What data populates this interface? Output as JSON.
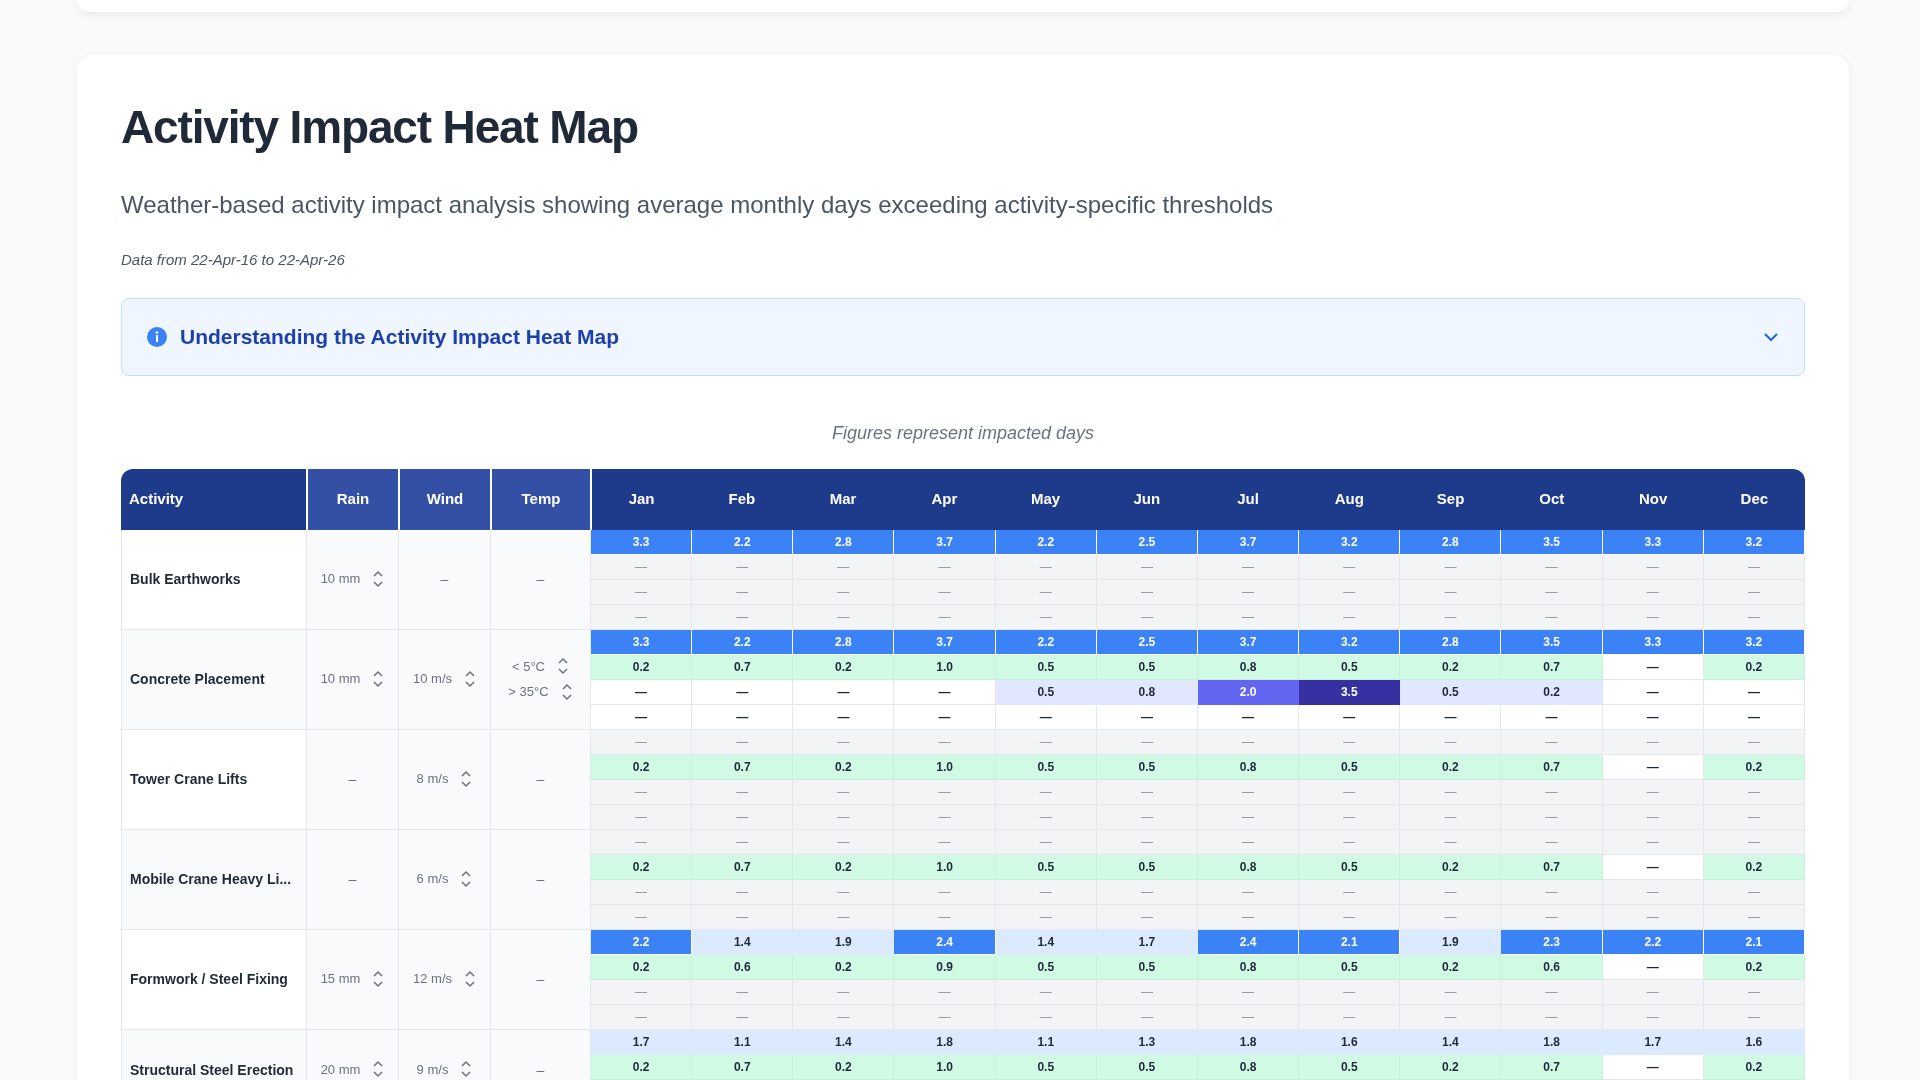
{
  "page_title": "Activity Impact Heat Map",
  "subtitle": "Weather-based activity impact analysis showing average monthly days exceeding activity-specific thresholds",
  "date_range": "Data from 22-Apr-16 to 22-Apr-26",
  "info_panel": {
    "title": "Understanding the Activity Impact Heat Map",
    "expanded": false
  },
  "caption": "Figures represent impacted days",
  "table": {
    "columns": [
      "Activity",
      "Rain",
      "Wind",
      "Temp"
    ],
    "months": [
      "Jan",
      "Feb",
      "Mar",
      "Apr",
      "May",
      "Jun",
      "Jul",
      "Aug",
      "Sep",
      "Oct",
      "Nov",
      "Dec"
    ],
    "activities": [
      {
        "name": "Bulk Earthworks",
        "rain": [
          {
            "text": "10 mm",
            "kind": "stepper"
          }
        ],
        "wind": [
          {
            "text": "–",
            "kind": "none"
          }
        ],
        "temp": [
          {
            "text": "–",
            "kind": "none"
          }
        ],
        "rows": [
          {
            "cells": [
              {
                "value": "3.3",
                "kind": "rain-high"
              },
              {
                "value": "2.2",
                "kind": "rain-high"
              },
              {
                "value": "2.8",
                "kind": "rain-high"
              },
              {
                "value": "3.7",
                "kind": "rain-high"
              },
              {
                "value": "2.2",
                "kind": "rain-high"
              },
              {
                "value": "2.5",
                "kind": "rain-high"
              },
              {
                "value": "3.7",
                "kind": "rain-high"
              },
              {
                "value": "3.2",
                "kind": "rain-high"
              },
              {
                "value": "2.8",
                "kind": "rain-high"
              },
              {
                "value": "3.5",
                "kind": "rain-high"
              },
              {
                "value": "3.3",
                "kind": "rain-high"
              },
              {
                "value": "3.2",
                "kind": "rain-high"
              }
            ]
          },
          {
            "cells": [
              {
                "value": "—",
                "kind": "na"
              },
              {
                "value": "—",
                "kind": "na"
              },
              {
                "value": "—",
                "kind": "na"
              },
              {
                "value": "—",
                "kind": "na"
              },
              {
                "value": "—",
                "kind": "na"
              },
              {
                "value": "—",
                "kind": "na"
              },
              {
                "value": "—",
                "kind": "na"
              },
              {
                "value": "—",
                "kind": "na"
              },
              {
                "value": "—",
                "kind": "na"
              },
              {
                "value": "—",
                "kind": "na"
              },
              {
                "value": "—",
                "kind": "na"
              },
              {
                "value": "—",
                "kind": "na"
              }
            ]
          },
          {
            "cells": [
              {
                "value": "—",
                "kind": "na"
              },
              {
                "value": "—",
                "kind": "na"
              },
              {
                "value": "—",
                "kind": "na"
              },
              {
                "value": "—",
                "kind": "na"
              },
              {
                "value": "—",
                "kind": "na"
              },
              {
                "value": "—",
                "kind": "na"
              },
              {
                "value": "—",
                "kind": "na"
              },
              {
                "value": "—",
                "kind": "na"
              },
              {
                "value": "—",
                "kind": "na"
              },
              {
                "value": "—",
                "kind": "na"
              },
              {
                "value": "—",
                "kind": "na"
              },
              {
                "value": "—",
                "kind": "na"
              }
            ]
          },
          {
            "cells": [
              {
                "value": "—",
                "kind": "na"
              },
              {
                "value": "—",
                "kind": "na"
              },
              {
                "value": "—",
                "kind": "na"
              },
              {
                "value": "—",
                "kind": "na"
              },
              {
                "value": "—",
                "kind": "na"
              },
              {
                "value": "—",
                "kind": "na"
              },
              {
                "value": "—",
                "kind": "na"
              },
              {
                "value": "—",
                "kind": "na"
              },
              {
                "value": "—",
                "kind": "na"
              },
              {
                "value": "—",
                "kind": "na"
              },
              {
                "value": "—",
                "kind": "na"
              },
              {
                "value": "—",
                "kind": "na"
              }
            ]
          }
        ]
      },
      {
        "name": "Concrete Placement",
        "rain": [
          {
            "text": "10 mm",
            "kind": "stepper"
          }
        ],
        "wind": [
          {
            "text": "10 m/s",
            "kind": "stepper"
          }
        ],
        "temp": [
          {
            "text": "< 5°C",
            "kind": "stepper"
          },
          {
            "text": "> 35°C",
            "kind": "stepper"
          }
        ],
        "rows": [
          {
            "cells": [
              {
                "value": "3.3",
                "kind": "rain-high"
              },
              {
                "value": "2.2",
                "kind": "rain-high"
              },
              {
                "value": "2.8",
                "kind": "rain-high"
              },
              {
                "value": "3.7",
                "kind": "rain-high"
              },
              {
                "value": "2.2",
                "kind": "rain-high"
              },
              {
                "value": "2.5",
                "kind": "rain-high"
              },
              {
                "value": "3.7",
                "kind": "rain-high"
              },
              {
                "value": "3.2",
                "kind": "rain-high"
              },
              {
                "value": "2.8",
                "kind": "rain-high"
              },
              {
                "value": "3.5",
                "kind": "rain-high"
              },
              {
                "value": "3.3",
                "kind": "rain-high"
              },
              {
                "value": "3.2",
                "kind": "rain-high"
              }
            ]
          },
          {
            "cells": [
              {
                "value": "0.2",
                "kind": "wind"
              },
              {
                "value": "0.7",
                "kind": "wind"
              },
              {
                "value": "0.2",
                "kind": "wind"
              },
              {
                "value": "1.0",
                "kind": "wind"
              },
              {
                "value": "0.5",
                "kind": "wind"
              },
              {
                "value": "0.5",
                "kind": "wind"
              },
              {
                "value": "0.8",
                "kind": "wind"
              },
              {
                "value": "0.5",
                "kind": "wind"
              },
              {
                "value": "0.2",
                "kind": "wind"
              },
              {
                "value": "0.7",
                "kind": "wind"
              },
              {
                "value": "—",
                "kind": "zero"
              },
              {
                "value": "0.2",
                "kind": "wind"
              }
            ]
          },
          {
            "cells": [
              {
                "value": "—",
                "kind": "zero"
              },
              {
                "value": "—",
                "kind": "zero"
              },
              {
                "value": "—",
                "kind": "zero"
              },
              {
                "value": "—",
                "kind": "zero"
              },
              {
                "value": "0.5",
                "kind": "temp-low"
              },
              {
                "value": "0.8",
                "kind": "temp-low"
              },
              {
                "value": "2.0",
                "kind": "temp-mid"
              },
              {
                "value": "3.5",
                "kind": "temp-high"
              },
              {
                "value": "0.5",
                "kind": "temp-low"
              },
              {
                "value": "0.2",
                "kind": "temp-low"
              },
              {
                "value": "—",
                "kind": "zero"
              },
              {
                "value": "—",
                "kind": "zero"
              }
            ]
          },
          {
            "cells": [
              {
                "value": "—",
                "kind": "zero"
              },
              {
                "value": "—",
                "kind": "zero"
              },
              {
                "value": "—",
                "kind": "zero"
              },
              {
                "value": "—",
                "kind": "zero"
              },
              {
                "value": "—",
                "kind": "zero"
              },
              {
                "value": "—",
                "kind": "zero"
              },
              {
                "value": "—",
                "kind": "zero"
              },
              {
                "value": "—",
                "kind": "zero"
              },
              {
                "value": "—",
                "kind": "zero"
              },
              {
                "value": "—",
                "kind": "zero"
              },
              {
                "value": "—",
                "kind": "zero"
              },
              {
                "value": "—",
                "kind": "zero"
              }
            ]
          }
        ]
      },
      {
        "name": "Tower Crane Lifts",
        "rain": [
          {
            "text": "–",
            "kind": "none"
          }
        ],
        "wind": [
          {
            "text": "8 m/s",
            "kind": "stepper"
          }
        ],
        "temp": [
          {
            "text": "–",
            "kind": "none"
          }
        ],
        "rows": [
          {
            "cells": [
              {
                "value": "—",
                "kind": "na"
              },
              {
                "value": "—",
                "kind": "na"
              },
              {
                "value": "—",
                "kind": "na"
              },
              {
                "value": "—",
                "kind": "na"
              },
              {
                "value": "—",
                "kind": "na"
              },
              {
                "value": "—",
                "kind": "na"
              },
              {
                "value": "—",
                "kind": "na"
              },
              {
                "value": "—",
                "kind": "na"
              },
              {
                "value": "—",
                "kind": "na"
              },
              {
                "value": "—",
                "kind": "na"
              },
              {
                "value": "—",
                "kind": "na"
              },
              {
                "value": "—",
                "kind": "na"
              }
            ]
          },
          {
            "cells": [
              {
                "value": "0.2",
                "kind": "wind"
              },
              {
                "value": "0.7",
                "kind": "wind"
              },
              {
                "value": "0.2",
                "kind": "wind"
              },
              {
                "value": "1.0",
                "kind": "wind"
              },
              {
                "value": "0.5",
                "kind": "wind"
              },
              {
                "value": "0.5",
                "kind": "wind"
              },
              {
                "value": "0.8",
                "kind": "wind"
              },
              {
                "value": "0.5",
                "kind": "wind"
              },
              {
                "value": "0.2",
                "kind": "wind"
              },
              {
                "value": "0.7",
                "kind": "wind"
              },
              {
                "value": "—",
                "kind": "zero"
              },
              {
                "value": "0.2",
                "kind": "wind"
              }
            ]
          },
          {
            "cells": [
              {
                "value": "—",
                "kind": "na"
              },
              {
                "value": "—",
                "kind": "na"
              },
              {
                "value": "—",
                "kind": "na"
              },
              {
                "value": "—",
                "kind": "na"
              },
              {
                "value": "—",
                "kind": "na"
              },
              {
                "value": "—",
                "kind": "na"
              },
              {
                "value": "—",
                "kind": "na"
              },
              {
                "value": "—",
                "kind": "na"
              },
              {
                "value": "—",
                "kind": "na"
              },
              {
                "value": "—",
                "kind": "na"
              },
              {
                "value": "—",
                "kind": "na"
              },
              {
                "value": "—",
                "kind": "na"
              }
            ]
          },
          {
            "cells": [
              {
                "value": "—",
                "kind": "na"
              },
              {
                "value": "—",
                "kind": "na"
              },
              {
                "value": "—",
                "kind": "na"
              },
              {
                "value": "—",
                "kind": "na"
              },
              {
                "value": "—",
                "kind": "na"
              },
              {
                "value": "—",
                "kind": "na"
              },
              {
                "value": "—",
                "kind": "na"
              },
              {
                "value": "—",
                "kind": "na"
              },
              {
                "value": "—",
                "kind": "na"
              },
              {
                "value": "—",
                "kind": "na"
              },
              {
                "value": "—",
                "kind": "na"
              },
              {
                "value": "—",
                "kind": "na"
              }
            ]
          }
        ]
      },
      {
        "name": "Mobile Crane Heavy Li...",
        "rain": [
          {
            "text": "–",
            "kind": "none"
          }
        ],
        "wind": [
          {
            "text": "6 m/s",
            "kind": "stepper"
          }
        ],
        "temp": [
          {
            "text": "–",
            "kind": "none"
          }
        ],
        "rows": [
          {
            "cells": [
              {
                "value": "—",
                "kind": "na"
              },
              {
                "value": "—",
                "kind": "na"
              },
              {
                "value": "—",
                "kind": "na"
              },
              {
                "value": "—",
                "kind": "na"
              },
              {
                "value": "—",
                "kind": "na"
              },
              {
                "value": "—",
                "kind": "na"
              },
              {
                "value": "—",
                "kind": "na"
              },
              {
                "value": "—",
                "kind": "na"
              },
              {
                "value": "—",
                "kind": "na"
              },
              {
                "value": "—",
                "kind": "na"
              },
              {
                "value": "—",
                "kind": "na"
              },
              {
                "value": "—",
                "kind": "na"
              }
            ]
          },
          {
            "cells": [
              {
                "value": "0.2",
                "kind": "wind"
              },
              {
                "value": "0.7",
                "kind": "wind"
              },
              {
                "value": "0.2",
                "kind": "wind"
              },
              {
                "value": "1.0",
                "kind": "wind"
              },
              {
                "value": "0.5",
                "kind": "wind"
              },
              {
                "value": "0.5",
                "kind": "wind"
              },
              {
                "value": "0.8",
                "kind": "wind"
              },
              {
                "value": "0.5",
                "kind": "wind"
              },
              {
                "value": "0.2",
                "kind": "wind"
              },
              {
                "value": "0.7",
                "kind": "wind"
              },
              {
                "value": "—",
                "kind": "zero"
              },
              {
                "value": "0.2",
                "kind": "wind"
              }
            ]
          },
          {
            "cells": [
              {
                "value": "—",
                "kind": "na"
              },
              {
                "value": "—",
                "kind": "na"
              },
              {
                "value": "—",
                "kind": "na"
              },
              {
                "value": "—",
                "kind": "na"
              },
              {
                "value": "—",
                "kind": "na"
              },
              {
                "value": "—",
                "kind": "na"
              },
              {
                "value": "—",
                "kind": "na"
              },
              {
                "value": "—",
                "kind": "na"
              },
              {
                "value": "—",
                "kind": "na"
              },
              {
                "value": "—",
                "kind": "na"
              },
              {
                "value": "—",
                "kind": "na"
              },
              {
                "value": "—",
                "kind": "na"
              }
            ]
          },
          {
            "cells": [
              {
                "value": "—",
                "kind": "na"
              },
              {
                "value": "—",
                "kind": "na"
              },
              {
                "value": "—",
                "kind": "na"
              },
              {
                "value": "—",
                "kind": "na"
              },
              {
                "value": "—",
                "kind": "na"
              },
              {
                "value": "—",
                "kind": "na"
              },
              {
                "value": "—",
                "kind": "na"
              },
              {
                "value": "—",
                "kind": "na"
              },
              {
                "value": "—",
                "kind": "na"
              },
              {
                "value": "—",
                "kind": "na"
              },
              {
                "value": "—",
                "kind": "na"
              },
              {
                "value": "—",
                "kind": "na"
              }
            ]
          }
        ]
      },
      {
        "name": "Formwork / Steel Fixing",
        "rain": [
          {
            "text": "15 mm",
            "kind": "stepper"
          }
        ],
        "wind": [
          {
            "text": "12 m/s",
            "kind": "stepper"
          }
        ],
        "temp": [
          {
            "text": "–",
            "kind": "none"
          }
        ],
        "rows": [
          {
            "cells": [
              {
                "value": "2.2",
                "kind": "rain-high"
              },
              {
                "value": "1.4",
                "kind": "rain-low"
              },
              {
                "value": "1.9",
                "kind": "rain-low"
              },
              {
                "value": "2.4",
                "kind": "rain-high"
              },
              {
                "value": "1.4",
                "kind": "rain-low"
              },
              {
                "value": "1.7",
                "kind": "rain-low"
              },
              {
                "value": "2.4",
                "kind": "rain-high"
              },
              {
                "value": "2.1",
                "kind": "rain-high"
              },
              {
                "value": "1.9",
                "kind": "rain-low"
              },
              {
                "value": "2.3",
                "kind": "rain-high"
              },
              {
                "value": "2.2",
                "kind": "rain-high"
              },
              {
                "value": "2.1",
                "kind": "rain-high"
              }
            ]
          },
          {
            "cells": [
              {
                "value": "0.2",
                "kind": "wind"
              },
              {
                "value": "0.6",
                "kind": "wind"
              },
              {
                "value": "0.2",
                "kind": "wind"
              },
              {
                "value": "0.9",
                "kind": "wind"
              },
              {
                "value": "0.5",
                "kind": "wind"
              },
              {
                "value": "0.5",
                "kind": "wind"
              },
              {
                "value": "0.8",
                "kind": "wind"
              },
              {
                "value": "0.5",
                "kind": "wind"
              },
              {
                "value": "0.2",
                "kind": "wind"
              },
              {
                "value": "0.6",
                "kind": "wind"
              },
              {
                "value": "—",
                "kind": "zero"
              },
              {
                "value": "0.2",
                "kind": "wind"
              }
            ]
          },
          {
            "cells": [
              {
                "value": "—",
                "kind": "na"
              },
              {
                "value": "—",
                "kind": "na"
              },
              {
                "value": "—",
                "kind": "na"
              },
              {
                "value": "—",
                "kind": "na"
              },
              {
                "value": "—",
                "kind": "na"
              },
              {
                "value": "—",
                "kind": "na"
              },
              {
                "value": "—",
                "kind": "na"
              },
              {
                "value": "—",
                "kind": "na"
              },
              {
                "value": "—",
                "kind": "na"
              },
              {
                "value": "—",
                "kind": "na"
              },
              {
                "value": "—",
                "kind": "na"
              },
              {
                "value": "—",
                "kind": "na"
              }
            ]
          },
          {
            "cells": [
              {
                "value": "—",
                "kind": "na"
              },
              {
                "value": "—",
                "kind": "na"
              },
              {
                "value": "—",
                "kind": "na"
              },
              {
                "value": "—",
                "kind": "na"
              },
              {
                "value": "—",
                "kind": "na"
              },
              {
                "value": "—",
                "kind": "na"
              },
              {
                "value": "—",
                "kind": "na"
              },
              {
                "value": "—",
                "kind": "na"
              },
              {
                "value": "—",
                "kind": "na"
              },
              {
                "value": "—",
                "kind": "na"
              },
              {
                "value": "—",
                "kind": "na"
              },
              {
                "value": "—",
                "kind": "na"
              }
            ]
          }
        ]
      },
      {
        "name": "Structural Steel Erection",
        "rain": [
          {
            "text": "20 mm",
            "kind": "stepper"
          }
        ],
        "wind": [
          {
            "text": "9 m/s",
            "kind": "stepper"
          }
        ],
        "temp": [
          {
            "text": "–",
            "kind": "none"
          }
        ],
        "rows": [
          {
            "cells": [
              {
                "value": "1.7",
                "kind": "rain-low"
              },
              {
                "value": "1.1",
                "kind": "rain-low"
              },
              {
                "value": "1.4",
                "kind": "rain-low"
              },
              {
                "value": "1.8",
                "kind": "rain-low"
              },
              {
                "value": "1.1",
                "kind": "rain-low"
              },
              {
                "value": "1.3",
                "kind": "rain-low"
              },
              {
                "value": "1.8",
                "kind": "rain-low"
              },
              {
                "value": "1.6",
                "kind": "rain-low"
              },
              {
                "value": "1.4",
                "kind": "rain-low"
              },
              {
                "value": "1.8",
                "kind": "rain-low"
              },
              {
                "value": "1.7",
                "kind": "rain-low"
              },
              {
                "value": "1.6",
                "kind": "rain-low"
              }
            ]
          },
          {
            "cells": [
              {
                "value": "0.2",
                "kind": "wind"
              },
              {
                "value": "0.7",
                "kind": "wind"
              },
              {
                "value": "0.2",
                "kind": "wind"
              },
              {
                "value": "1.0",
                "kind": "wind"
              },
              {
                "value": "0.5",
                "kind": "wind"
              },
              {
                "value": "0.5",
                "kind": "wind"
              },
              {
                "value": "0.8",
                "kind": "wind"
              },
              {
                "value": "0.5",
                "kind": "wind"
              },
              {
                "value": "0.2",
                "kind": "wind"
              },
              {
                "value": "0.7",
                "kind": "wind"
              },
              {
                "value": "—",
                "kind": "zero"
              },
              {
                "value": "0.2",
                "kind": "wind"
              }
            ]
          }
        ]
      }
    ]
  }
}
